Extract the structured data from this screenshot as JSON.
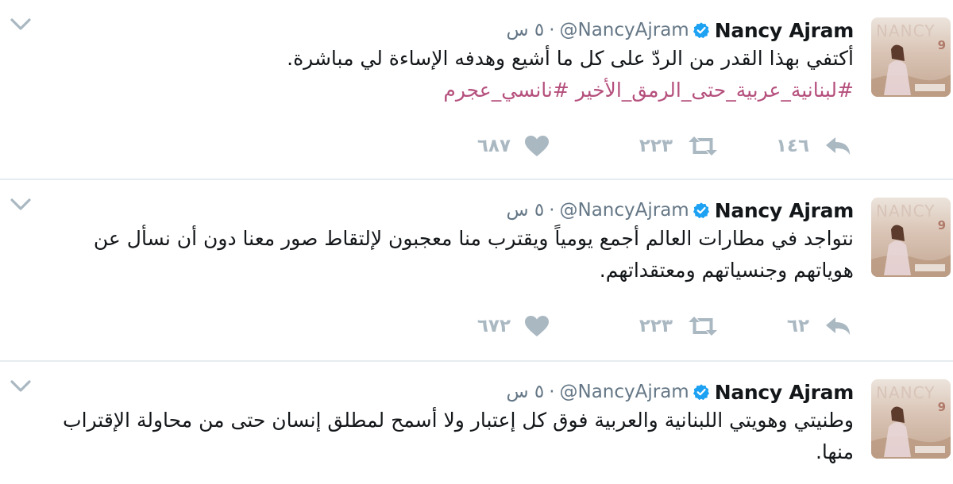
{
  "tweets": [
    {
      "author_name": "Nancy Ajram",
      "handle": "@NancyAjram",
      "separator": "·",
      "time": "٥ س",
      "text": "أكتفي بهذا القدر من الردّ على كل ما أشيع وهدفه الإساءة لي مباشرة.",
      "hashtags": "#لبنانية_عربية_حتى_الرمق_الأخير #نانسي_عجرم",
      "replies": "١٤٦",
      "retweets": "٢٢٣",
      "likes": "٦٨٧",
      "avatar_text": "NANCY",
      "avatar_number": "9"
    },
    {
      "author_name": "Nancy Ajram",
      "handle": "@NancyAjram",
      "separator": "·",
      "time": "٥ س",
      "text": "نتواجد في مطارات العالم أجمع يومياً ويقترب منا معجبون لإلتقاط صور معنا دون أن نسأل عن هوياتهم وجنسياتهم ومعتقداتهم.",
      "replies": "٦٢",
      "retweets": "٢٢٣",
      "likes": "٦٧٢",
      "avatar_text": "NANCY",
      "avatar_number": "9"
    },
    {
      "author_name": "Nancy Ajram",
      "handle": "@NancyAjram",
      "separator": "·",
      "time": "٥ س",
      "text": "وطنيتي وهويتي اللبنانية والعربية فوق كل إعتبار ولا أسمح لمطلق إنسان حتى من محاولة الإقتراب منها.",
      "avatar_text": "NANCY",
      "avatar_number": "9"
    }
  ],
  "colors": {
    "text": "#14171a",
    "secondary": "#657786",
    "icon_gray": "#aab8c2",
    "hashtag": "#b5507d",
    "verified": "#1da1f2",
    "divider": "#e6ecf0"
  },
  "icons": {
    "menu": "chevron-down-icon",
    "verified": "verified-badge-icon",
    "reply": "reply-icon",
    "retweet": "retweet-icon",
    "like": "heart-icon"
  }
}
